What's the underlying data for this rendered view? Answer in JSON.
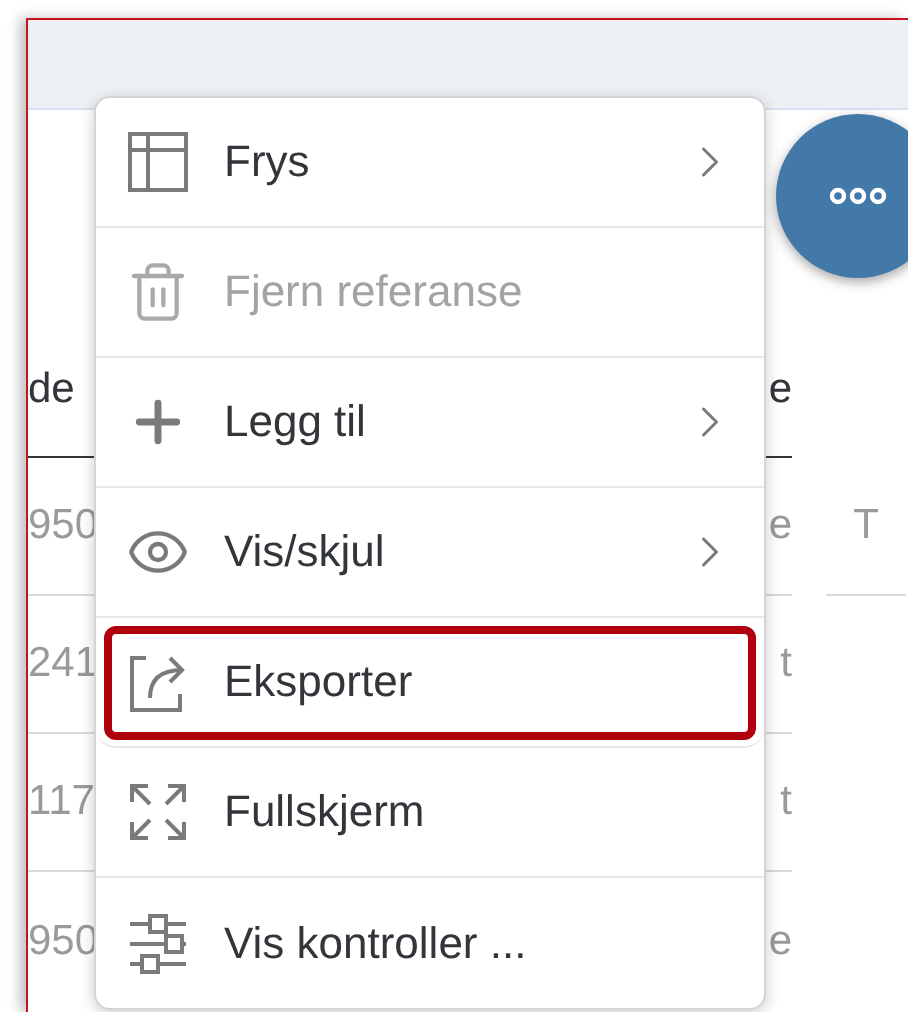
{
  "table": {
    "header": [
      "de",
      "e"
    ],
    "rows": [
      {
        "cells": [
          "950",
          "e",
          "T"
        ]
      },
      {
        "cells": [
          "241",
          "t"
        ]
      },
      {
        "cells": [
          "117",
          "t"
        ]
      },
      {
        "cells": [
          "950",
          "e"
        ]
      }
    ]
  },
  "menu": {
    "items": [
      {
        "label": "Frys",
        "submenu": true,
        "disabled": false,
        "highlighted": false
      },
      {
        "label": "Fjern referanse",
        "submenu": false,
        "disabled": true,
        "highlighted": false
      },
      {
        "label": "Legg til",
        "submenu": true,
        "disabled": false,
        "highlighted": false
      },
      {
        "label": "Vis/skjul",
        "submenu": true,
        "disabled": false,
        "highlighted": false
      },
      {
        "label": "Eksporter",
        "submenu": false,
        "disabled": false,
        "highlighted": true
      },
      {
        "label": "Fullskjerm",
        "submenu": false,
        "disabled": false,
        "highlighted": false
      },
      {
        "label": "Vis kontroller ...",
        "submenu": false,
        "disabled": false,
        "highlighted": false
      }
    ]
  }
}
